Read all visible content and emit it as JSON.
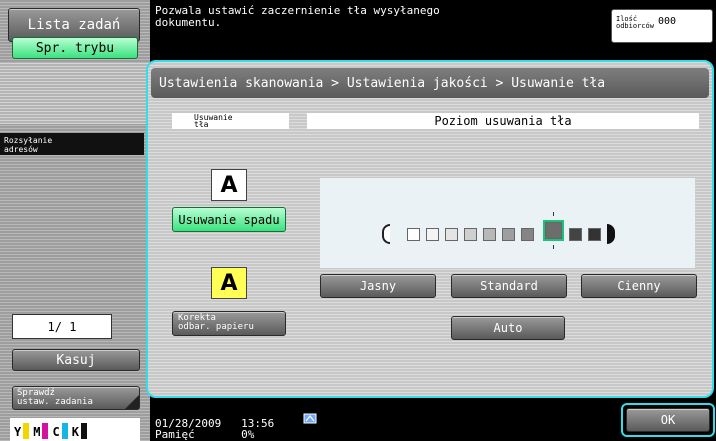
{
  "left": {
    "lista_zadan": "Lista zadań",
    "spr_trybu": "Spr. trybu",
    "rozsylanie": [
      "Rozsyłanie",
      "adresów"
    ],
    "page_indicator": "1/ 1",
    "kasuj": "Kasuj",
    "sprawdz": [
      "Sprawdź",
      "ustaw. zadania"
    ],
    "toner": [
      {
        "label": "Y",
        "color": "#f2d600"
      },
      {
        "label": "M",
        "color": "#d6129c"
      },
      {
        "label": "C",
        "color": "#16b5e6"
      },
      {
        "label": "K",
        "color": "#111111"
      }
    ]
  },
  "message": [
    "Pozwala ustawić zaczernienie tła wysyłanego",
    "dokumentu."
  ],
  "recipients": {
    "label": [
      "Ilość",
      "odbiorców"
    ],
    "count": "000"
  },
  "breadcrumb": "Ustawienia skanowania > Ustawienia jakości  > Usuwanie tła",
  "left_section": {
    "header": [
      "Usuwanie",
      "tła"
    ],
    "usuwanie_spadu": "Usuwanie spadu",
    "korekta": [
      "Korekta",
      "odbar. papieru"
    ],
    "icon_letter": "A"
  },
  "right_section": {
    "header": "Poziom usuwania tła",
    "levels": 9,
    "selected_level": 7,
    "jasny": "Jasny",
    "standard": "Standard",
    "cienny": "Cienny",
    "auto": "Auto"
  },
  "status": {
    "date": "01/28/2009",
    "time": "13:56",
    "memory_label": "Pamięć",
    "memory_value": "0%"
  },
  "ok": "OK",
  "colors": {
    "accent": "#2ee0ee",
    "green": "#3be17f"
  }
}
